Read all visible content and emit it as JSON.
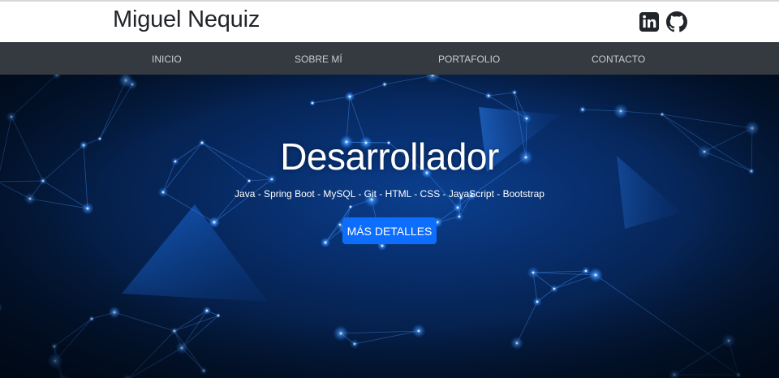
{
  "header": {
    "brand": "Miguel Nequiz",
    "social": [
      {
        "icon": "linkedin-icon"
      },
      {
        "icon": "github-icon"
      }
    ]
  },
  "nav": {
    "items": [
      {
        "label": "INICIO"
      },
      {
        "label": "SOBRE MÍ"
      },
      {
        "label": "PORTAFOLIO"
      },
      {
        "label": "CONTACTO"
      }
    ]
  },
  "hero": {
    "title": "Desarrollador",
    "subtitle": "Java - Spring Boot - MySQL - Git - HTML - CSS - JavaScript - Bootstrap",
    "button_label": "MÁS DETALLES",
    "background": "blue network mesh"
  },
  "colors": {
    "navbar": "#343a40",
    "nav_text": "#c9ccd0",
    "button": "#0d6efd",
    "hero_base": "#072a63"
  }
}
